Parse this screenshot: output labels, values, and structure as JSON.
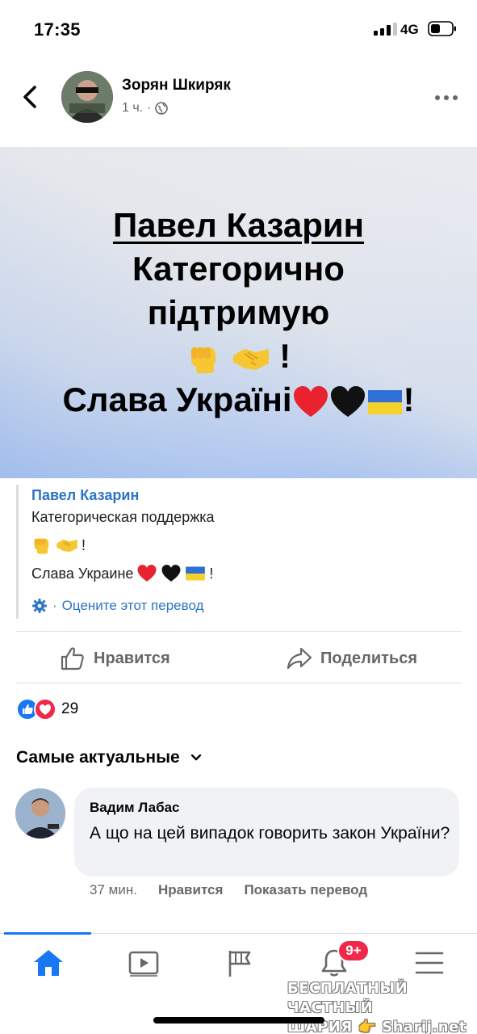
{
  "status_bar": {
    "time": "17:35",
    "network": "4G"
  },
  "post": {
    "author": "Зорян Шкиряк",
    "time_ago": "1 ч.",
    "separator": "·",
    "privacy_icon": "globe-icon",
    "more_icon": "more-horizontal-icon",
    "back_icon": "chevron-left-icon"
  },
  "image": {
    "line1": "Павел Казарин",
    "line2": "Категорично",
    "line3": "підтримую",
    "line4_suffix": "!",
    "line5": "Слава Україні",
    "line5_suffix": "!"
  },
  "translation": {
    "title": "Павел Казарин",
    "line1": "Категорическая поддержка",
    "line2_suffix": "!",
    "line3": "Слава Украине",
    "line3_suffix": "!",
    "rate_separator": "·",
    "rate_label": "Оцените этот перевод"
  },
  "actions": {
    "like_label": "Нравится",
    "share_label": "Поделиться"
  },
  "reactions": {
    "count": "29"
  },
  "sort": {
    "label": "Самые актуальные"
  },
  "comment": {
    "author": "Вадим Лабас",
    "text": "А що на цей випадок говорить закон України?",
    "time": "37 мин.",
    "like_label": "Нравится",
    "translate_label": "Показать перевод"
  },
  "tabbar": {
    "notifications_badge": "9+",
    "tabs": [
      "home-icon",
      "video-icon",
      "pages-icon",
      "bell-icon",
      "menu-icon"
    ]
  },
  "watermark": {
    "line1": "БЕСПЛАТНЫЙ ЧАСТНЫЙ",
    "line2": "ШАРИЯ 👉 Sharij.net"
  },
  "colors": {
    "accent": "#1877f2",
    "link": "#2d73c6",
    "badge": "#f02849",
    "secondary_text": "#65676b"
  }
}
